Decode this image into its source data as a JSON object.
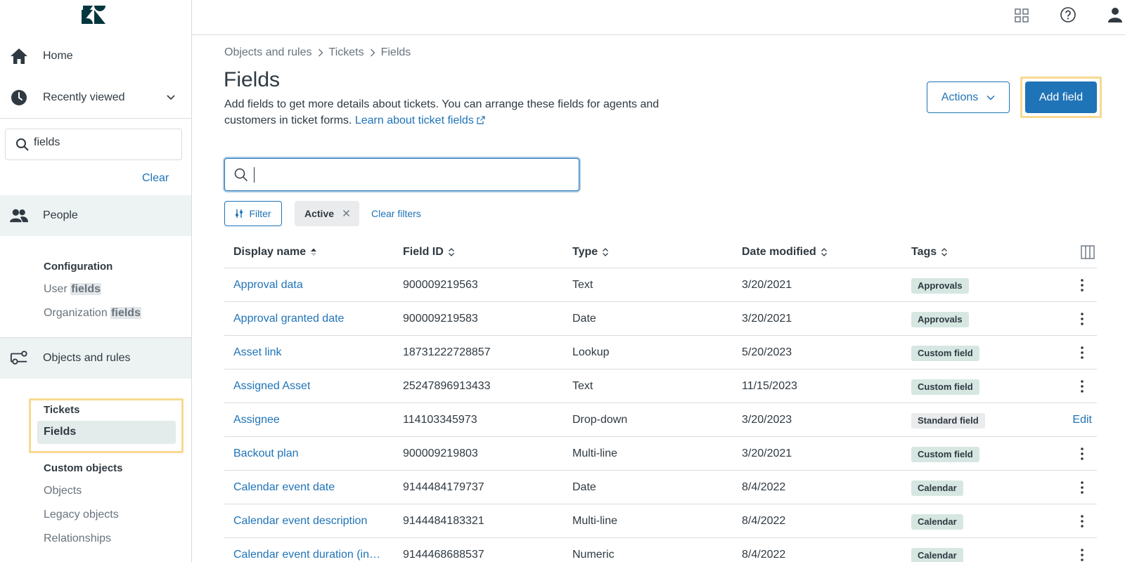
{
  "sidebar": {
    "home_label": "Home",
    "recent_label": "Recently viewed",
    "search_value": "fields",
    "clear_label": "Clear",
    "people_label": "People",
    "configuration_heading": "Configuration",
    "user_fields_prefix": "User",
    "user_fields_highlight": "fields",
    "org_fields_prefix": "Organization",
    "org_fields_highlight": "fields",
    "objects_rules_label": "Objects and rules",
    "tickets_heading": "Tickets",
    "fields_item": "Fields",
    "custom_objects_heading": "Custom objects",
    "objects_item": "Objects",
    "legacy_objects_item": "Legacy objects",
    "relationships_item": "Relationships"
  },
  "breadcrumb": [
    "Objects and rules",
    "Tickets",
    "Fields"
  ],
  "page": {
    "title": "Fields",
    "description": "Add fields to get more details about tickets. You can arrange these fields for agents and customers in ticket forms.",
    "learn_link": "Learn about ticket fields",
    "actions_label": "Actions",
    "add_label": "Add field"
  },
  "filters": {
    "search_value": "",
    "filter_label": "Filter",
    "chip_label": "Active",
    "clear_filters_label": "Clear filters"
  },
  "table": {
    "headers": [
      "Display name",
      "Field ID",
      "Type",
      "Date modified",
      "Tags"
    ],
    "rows": [
      {
        "name": "Approval data",
        "id": "900009219563",
        "type": "Text",
        "date": "3/20/2021",
        "tag": "Approvals",
        "action": "menu"
      },
      {
        "name": "Approval granted date",
        "id": "900009219583",
        "type": "Date",
        "date": "3/20/2021",
        "tag": "Approvals",
        "action": "menu"
      },
      {
        "name": "Asset link",
        "id": "18731222728857",
        "type": "Lookup",
        "date": "5/20/2023",
        "tag": "Custom field",
        "action": "menu"
      },
      {
        "name": "Assigned Asset",
        "id": "25247896913433",
        "type": "Text",
        "date": "11/15/2023",
        "tag": "Custom field",
        "action": "menu"
      },
      {
        "name": "Assignee",
        "id": "114103345973",
        "type": "Drop-down",
        "date": "3/20/2023",
        "tag": "Standard field",
        "action": "Edit"
      },
      {
        "name": "Backout plan",
        "id": "900009219803",
        "type": "Multi-line",
        "date": "3/20/2021",
        "tag": "Custom field",
        "action": "menu"
      },
      {
        "name": "Calendar event date",
        "id": "9144484179737",
        "type": "Date",
        "date": "8/4/2022",
        "tag": "Calendar",
        "action": "menu"
      },
      {
        "name": "Calendar event description",
        "id": "9144484183321",
        "type": "Multi-line",
        "date": "8/4/2022",
        "tag": "Calendar",
        "action": "menu"
      },
      {
        "name": "Calendar event duration (in…",
        "id": "9144468688537",
        "type": "Numeric",
        "date": "8/4/2022",
        "tag": "Calendar",
        "action": "menu"
      }
    ]
  },
  "colors": {
    "accent": "#1f73b7",
    "highlight_border": "#f8d992",
    "tag_green": "#d6e7e2",
    "tag_grey": "#e9ebed"
  }
}
